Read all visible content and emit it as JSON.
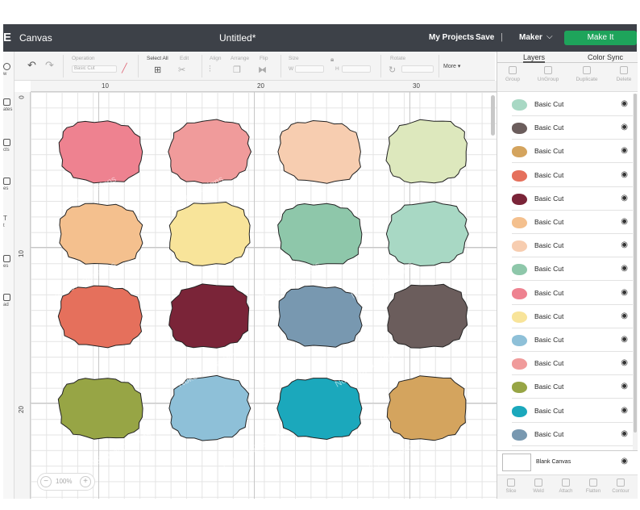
{
  "app": {
    "menu_glyph": "E",
    "name": "Canvas",
    "document_title": "Untitled*",
    "my_projects": "My Projects",
    "save": "Save",
    "separator": "|",
    "machine": "Maker",
    "make_it": "Make It"
  },
  "left_rail": [
    "w",
    "ates",
    "cts",
    "es",
    "t",
    "es",
    "ad"
  ],
  "edit_toolbar": {
    "operation_label": "Operation",
    "operation_value": "Basic Cut",
    "select_all": "Select All",
    "edit": "Edit",
    "align": "Align",
    "arrange": "Arrange",
    "flip": "Flip",
    "size": "Size",
    "width_label": "W",
    "height_label": "H",
    "rotate": "Rotate",
    "more": "More ▾"
  },
  "panel": {
    "tabs": [
      "Layers",
      "Color Sync"
    ],
    "actions": [
      "Group",
      "UnGroup",
      "Duplicate",
      "Delete"
    ],
    "layers": [
      {
        "label": "Basic Cut",
        "color": "#a8d8c4"
      },
      {
        "label": "Basic Cut",
        "color": "#6b5d5c"
      },
      {
        "label": "Basic Cut",
        "color": "#d4a45e"
      },
      {
        "label": "Basic Cut",
        "color": "#e5705c"
      },
      {
        "label": "Basic Cut",
        "color": "#7a2438"
      },
      {
        "label": "Basic Cut",
        "color": "#f4c08e"
      },
      {
        "label": "Basic Cut",
        "color": "#f7cdb0"
      },
      {
        "label": "Basic Cut",
        "color": "#8ec7aa"
      },
      {
        "label": "Basic Cut",
        "color": "#ee8290"
      },
      {
        "label": "Basic Cut",
        "color": "#f8e49a"
      },
      {
        "label": "Basic Cut",
        "color": "#8ec0d8"
      },
      {
        "label": "Basic Cut",
        "color": "#f09b9b"
      },
      {
        "label": "Basic Cut",
        "color": "#97a545"
      },
      {
        "label": "Basic Cut",
        "color": "#1ba8bc"
      },
      {
        "label": "Basic Cut",
        "color": "#7898b0"
      }
    ],
    "blank_canvas": "Blank Canvas",
    "bottom_actions": [
      "Slice",
      "Weld",
      "Attach",
      "Flatten",
      "Contour"
    ]
  },
  "canvas": {
    "ruler_top": [
      "10",
      "20",
      "30"
    ],
    "ruler_left": [
      "0",
      "10",
      "20"
    ],
    "zoom": "100%",
    "zoom_minus": "−",
    "zoom_plus": "+",
    "watermark": "NokShopDesigns",
    "shapes": [
      {
        "color": "#ee8290"
      },
      {
        "color": "#f09b9b"
      },
      {
        "color": "#f7cdb0"
      },
      {
        "color": "#dde8bd"
      },
      {
        "color": "#f4c08e"
      },
      {
        "color": "#f8e49a"
      },
      {
        "color": "#8ec7aa"
      },
      {
        "color": "#a8d8c4"
      },
      {
        "color": "#e5705c"
      },
      {
        "color": "#7a2438"
      },
      {
        "color": "#7898b0"
      },
      {
        "color": "#6b5d5c"
      },
      {
        "color": "#97a545"
      },
      {
        "color": "#8ec0d8"
      },
      {
        "color": "#1ba8bc"
      },
      {
        "color": "#d4a45e"
      }
    ]
  }
}
